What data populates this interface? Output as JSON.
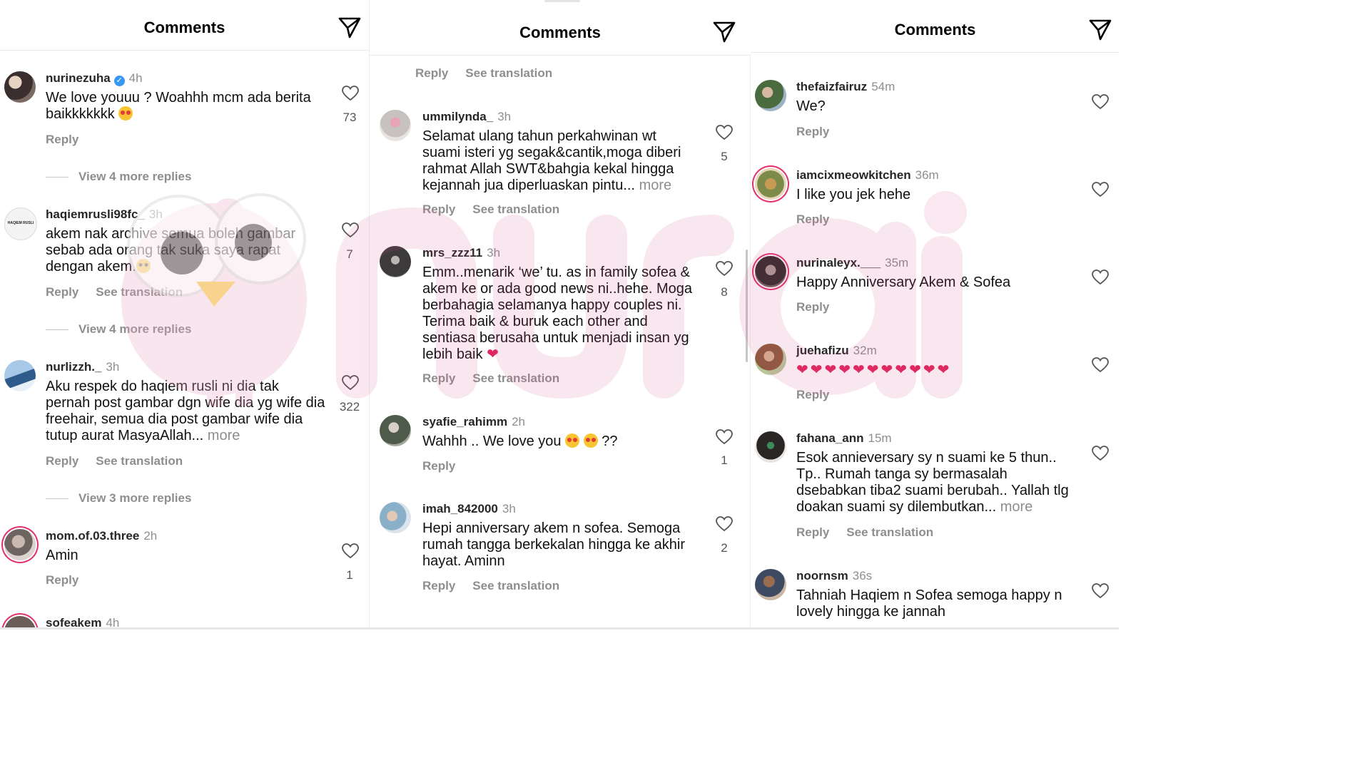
{
  "colors": {
    "text": "#111111",
    "secondary": "#8e8e8e",
    "verified": "#3897f0",
    "story_ring": "#e1306c",
    "watermark": "#e8b4c8"
  },
  "icons": [
    "send-icon",
    "heart-icon",
    "verified-badge-icon",
    "avatar"
  ],
  "panels": [
    {
      "title": "Comments",
      "comments": [
        {
          "user": "nurinezuha",
          "verified": true,
          "time": "4h",
          "text": "We love youuu ? Woahhh mcm ada berita baikkkkkkk",
          "emoji": "heart-eyes",
          "actions": [
            "Reply"
          ],
          "likes": "73",
          "replies_label": "View 4 more replies"
        },
        {
          "user": "haqiemrusli98fc_",
          "time": "3h",
          "text": "akem nak archive semua boleh gambar sebab ada orang tak suka saya rapat dengan akem.",
          "emoji": "pleading",
          "actions": [
            "Reply",
            "See translation"
          ],
          "likes": "7",
          "replies_label": "View 4 more replies",
          "avatar_text": "HAQIEM RUSLI"
        },
        {
          "user": "nurlizzh._",
          "time": "3h",
          "text": "Aku respek do haqiem rusli ni dia tak pernah post gambar dgn wife dia yg wife dia freehair, semua dia post gambar wife dia tutup aurat MasyaAllah...",
          "more": "more",
          "actions": [
            "Reply",
            "See translation"
          ],
          "likes": "322",
          "replies_label": "View 3 more replies"
        },
        {
          "user": "mom.of.03.three",
          "time": "2h",
          "text": "Amin",
          "actions": [
            "Reply"
          ],
          "likes": "1"
        },
        {
          "user": "sofeakem",
          "time": "4h"
        }
      ]
    },
    {
      "title": "Comments",
      "comments": [
        {
          "actions": [
            "Reply",
            "See translation"
          ]
        },
        {
          "user": "ummilynda_",
          "time": "3h",
          "text": "Selamat ulang tahun perkahwinan wt suami isteri yg segak&cantik,moga diberi rahmat Allah SWT&bahgia kekal hingga kejannah jua diperluaskan pintu...",
          "more": "more",
          "actions": [
            "Reply",
            "See translation"
          ],
          "likes": "5"
        },
        {
          "user": "mrs_zzz11",
          "time": "3h",
          "text": "Emm..menarik ‘we’ tu. as in family sofea & akem ke or ada good news ni..hehe. Moga berbahagia selamanya happy couples ni. Terima baik & buruk each other and sentiasa berusaha untuk menjadi insan yg lebih baik",
          "emoji": "red-heart",
          "actions": [
            "Reply",
            "See translation"
          ],
          "likes": "8"
        },
        {
          "user": "syafie_rahimm",
          "time": "2h",
          "text": "Wahhh .. We love you",
          "text_after": "??",
          "emoji": "heart-eyes-x2",
          "actions": [
            "Reply"
          ],
          "likes": "1"
        },
        {
          "user": "imah_842000",
          "time": "3h",
          "text": "Hepi anniversary akem n sofea. Semoga rumah tangga berkekalan hingga ke akhir hayat. Aminn",
          "actions": [
            "Reply",
            "See translation"
          ],
          "likes": "2"
        }
      ]
    },
    {
      "title": "Comments",
      "comments": [
        {
          "user": "thefaizfairuz",
          "time": "54m",
          "text": "We?",
          "actions": [
            "Reply"
          ]
        },
        {
          "user": "iamcixmeowkitchen",
          "time": "36m",
          "text": "I like you jek hehe",
          "actions": [
            "Reply"
          ]
        },
        {
          "user": "nurinaleyx.___",
          "time": "35m",
          "text": "Happy Anniversary Akem & Sofea",
          "actions": [
            "Reply"
          ]
        },
        {
          "user": "juehafizu",
          "time": "32m",
          "hearts": "❤❤❤❤❤❤❤❤❤❤❤",
          "actions": [
            "Reply"
          ]
        },
        {
          "user": "fahana_ann",
          "time": "15m",
          "text": "Esok annieversary sy n suami ke 5 thun.. Tp.. Rumah tanga sy bermasalah dsebabkan tiba2 suami berubah.. Yallah tlg doakan suami sy dilembutkan...",
          "more": "more",
          "actions": [
            "Reply",
            "See translation"
          ]
        },
        {
          "user": "noornsm",
          "time": "36s",
          "text": "Tahniah Haqiem n Sofea semoga happy n lovely hingga ke jannah"
        }
      ]
    }
  ]
}
